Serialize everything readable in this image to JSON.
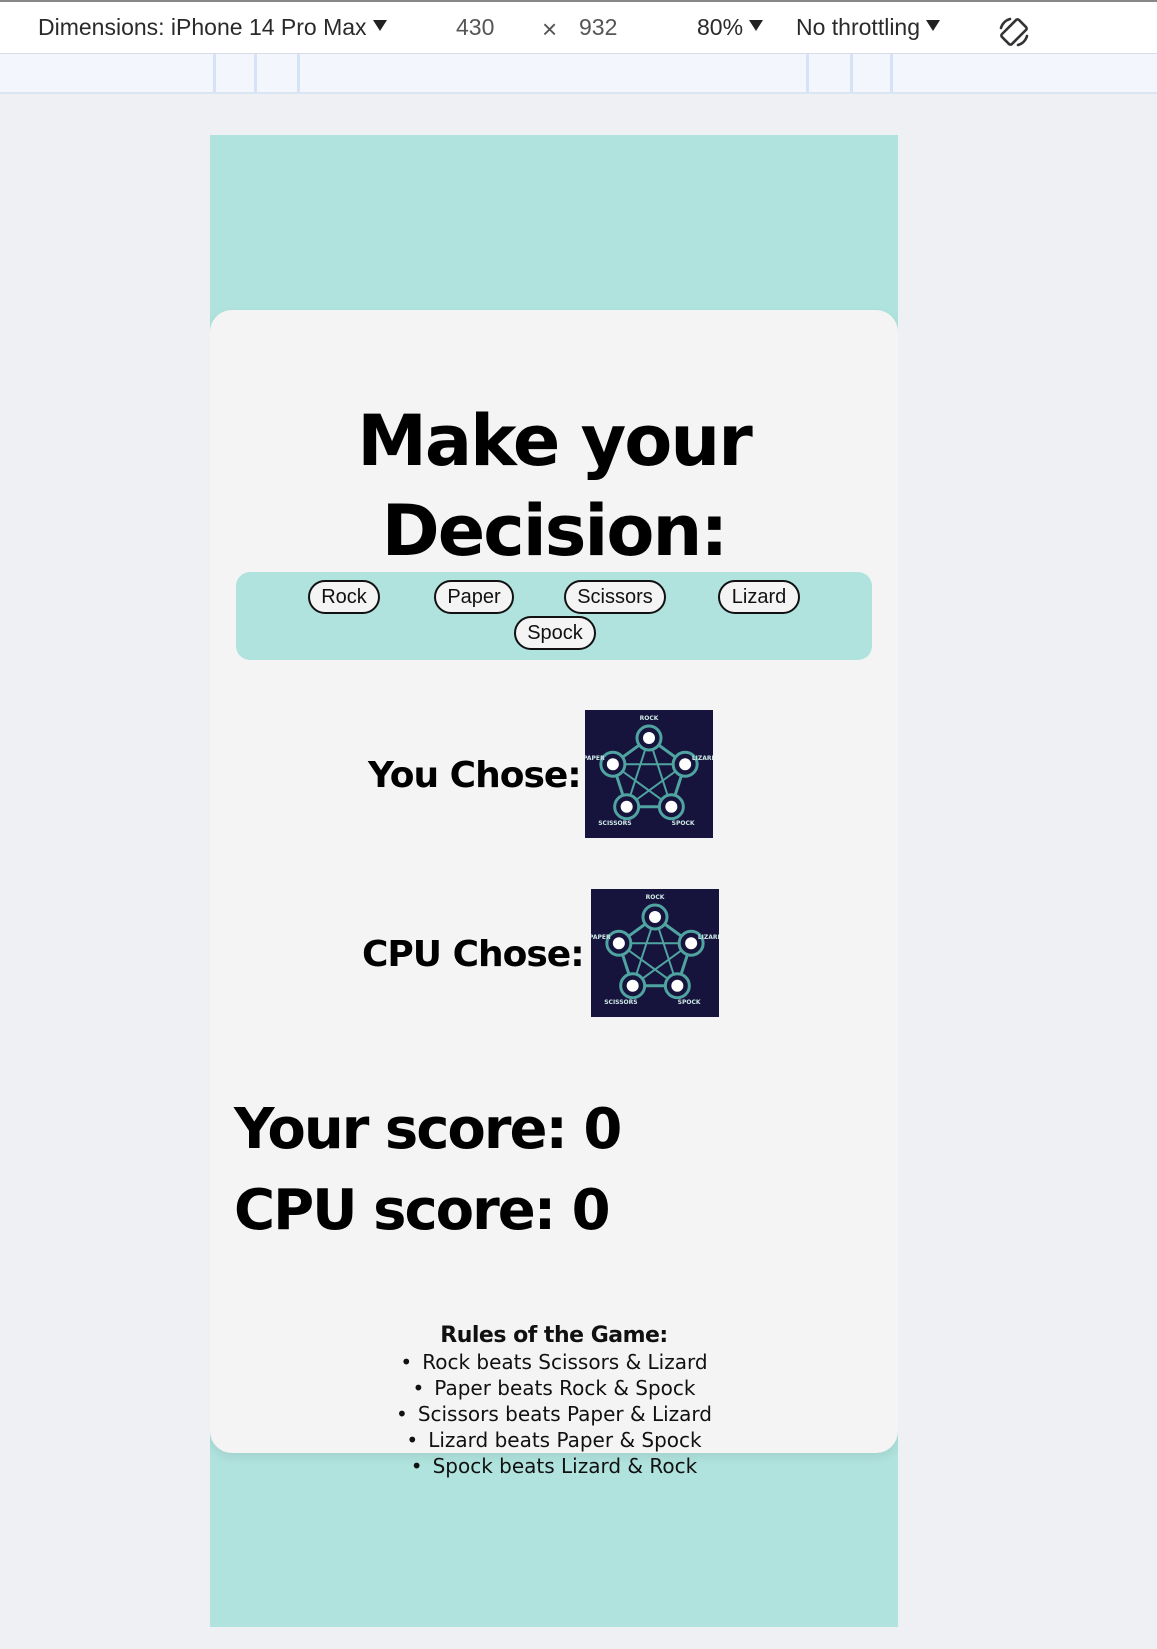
{
  "devtools": {
    "dimensions_label": "Dimensions: iPhone 14 Pro Max",
    "width": "430",
    "times": "×",
    "height": "932",
    "zoom": "80%",
    "throttling": "No throttling",
    "rotate_icon": "rotate-device-icon"
  },
  "game": {
    "heading_line1": "Make your",
    "heading_line2": "Decision:",
    "choices": [
      "Rock",
      "Paper",
      "Scissors",
      "Lizard",
      "Spock"
    ],
    "you_chose_label": "You Chose:",
    "cpu_chose_label": "CPU Chose:",
    "you_chose_image": "rock-paper-scissors-lizard-spock-diagram",
    "cpu_chose_image": "rock-paper-scissors-lizard-spock-diagram",
    "your_score": "Your score: 0",
    "cpu_score": "CPU score: 0",
    "rules_title": "Rules of the Game:",
    "rules": [
      "Rock beats Scissors & Lizard",
      "Paper beats Rock & Spock",
      "Scissors beats Paper & Lizard",
      "Lizard beats Paper & Spock",
      "Spock beats Lizard & Rock"
    ],
    "diagram_labels": [
      "ROCK",
      "LIZARD",
      "SPOCK",
      "SCISSORS",
      "PAPER"
    ]
  },
  "colors": {
    "page_background": "#b0e3de",
    "card_background": "#f4f4f4",
    "diagram_background": "#16143c",
    "diagram_accent": "#4fa3a0"
  }
}
